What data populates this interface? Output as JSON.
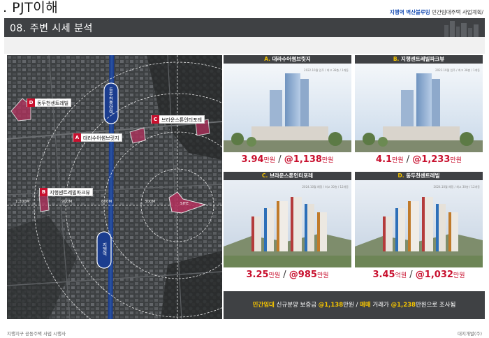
{
  "header": {
    "title": ". PJT이해",
    "project_highlight": "지행역 벽산블루밍",
    "project_rest": " 민간임대주택 사업계획/"
  },
  "section": {
    "title": "08. 주변 시세 분석"
  },
  "map": {
    "labels": [
      {
        "tag": "D",
        "name": "동두천센트레빌"
      },
      {
        "tag": "C",
        "name": "브라운스톤인터포레"
      },
      {
        "tag": "A",
        "name": "대라수어썸브릿지"
      },
      {
        "tag": "B",
        "name": "지행센트레빌파크뷰"
      }
    ],
    "rings": [
      "1,200M",
      "900M",
      "600M",
      "300M"
    ],
    "site_label": "SITE",
    "road_upper": "동두천중앙역",
    "road_lower": "지행역"
  },
  "cards": [
    {
      "letter": "A.",
      "name": "대라수어썸브릿지",
      "caption": "2022.10월 입주 / 최고 38층 / 1개동",
      "price_main": "3.94",
      "unit_main": "만원",
      "sep": " / ",
      "price_unit": "@1,138",
      "unit_unit": "만원"
    },
    {
      "letter": "B.",
      "name": "지행센트레빌파크뷰",
      "caption": "2022.10월 입주 / 최고 38층 / 1개동",
      "price_main": "4.1",
      "unit_main": "만원",
      "sep": " / ",
      "price_unit": "@1,233",
      "unit_unit": "만원"
    },
    {
      "letter": "C.",
      "name": "브라운스톤인터포레",
      "caption": "2024.10월 예정 / 최고 30층 / 12개동",
      "price_main": "3.25",
      "unit_main": "만원",
      "sep": " / ",
      "price_unit": "@985",
      "unit_unit": "만원"
    },
    {
      "letter": "D.",
      "name": "동두천센트레빌",
      "caption": "2024.10월 예정 / 최고 30층 / 12개동",
      "price_main": "3.45",
      "unit_main": "억원",
      "sep": " / ",
      "price_unit": "@1,032",
      "unit_unit": "만원"
    }
  ],
  "summary": {
    "p1": "민간임대",
    "p2": " 신규분양 보증금 ",
    "p3": "@1,138",
    "p4": "만원 / ",
    "p5": "매매",
    "p6": " 거래가 ",
    "p7": "@1,238",
    "p8": "만원으로 조사됨"
  },
  "footer": {
    "left": "지행지구 공동주택 사업 시행사",
    "right": "대지개발(주)"
  },
  "colors": {
    "accent_red": "#c8102e",
    "accent_yellow": "#f5c400",
    "bar_gray": "#3f4144",
    "road_blue": "#1b3d8f"
  }
}
